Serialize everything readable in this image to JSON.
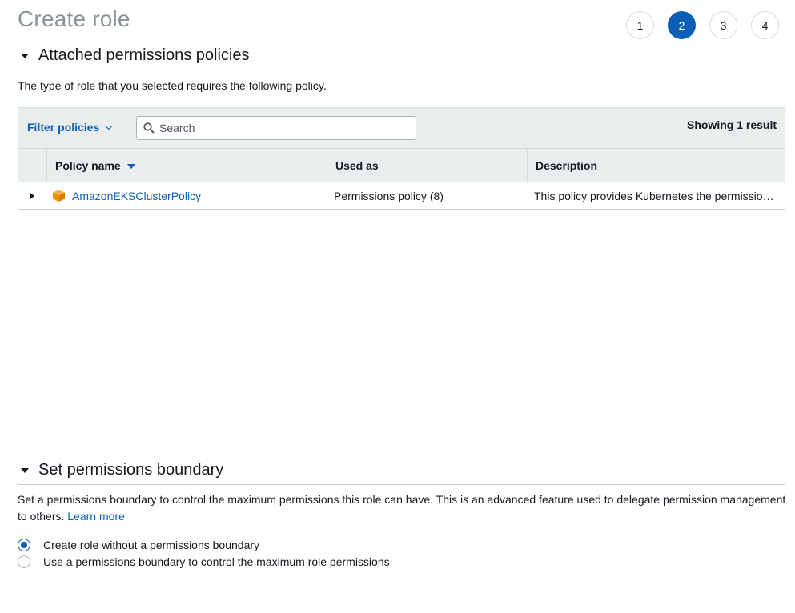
{
  "page": {
    "title": "Create role"
  },
  "steps": [
    "1",
    "2",
    "3",
    "4"
  ],
  "attached": {
    "title": "Attached permissions policies",
    "description": "The type of role that you selected requires the following policy."
  },
  "toolbar": {
    "filter_label": "Filter policies",
    "search_placeholder": "Search",
    "showing": "Showing 1 result"
  },
  "table": {
    "columns": [
      "Policy name",
      "Used as",
      "Description"
    ],
    "rows": [
      {
        "name": "AmazonEKSClusterPolicy",
        "used_as": "Permissions policy (8)",
        "description": "This policy provides Kubernetes the permissio…"
      }
    ]
  },
  "boundary": {
    "title": "Set permissions boundary",
    "description": "Set a permissions boundary to control the maximum permissions this role can have. This is an advanced feature used to delegate permission management to others.",
    "learn_more": "Learn more",
    "options": [
      {
        "label": "Create role without a permissions boundary",
        "checked": true
      },
      {
        "label": "Use a permissions boundary to control the maximum role permissions",
        "checked": false
      }
    ]
  },
  "colors": {
    "accent": "#0a5fb4",
    "policy_icon": "#f29100"
  },
  "icons": [
    "caret-down-icon",
    "search-icon",
    "chevron-down-icon",
    "sort-desc-icon",
    "caret-right-icon",
    "aws-managed-policy-icon"
  ]
}
